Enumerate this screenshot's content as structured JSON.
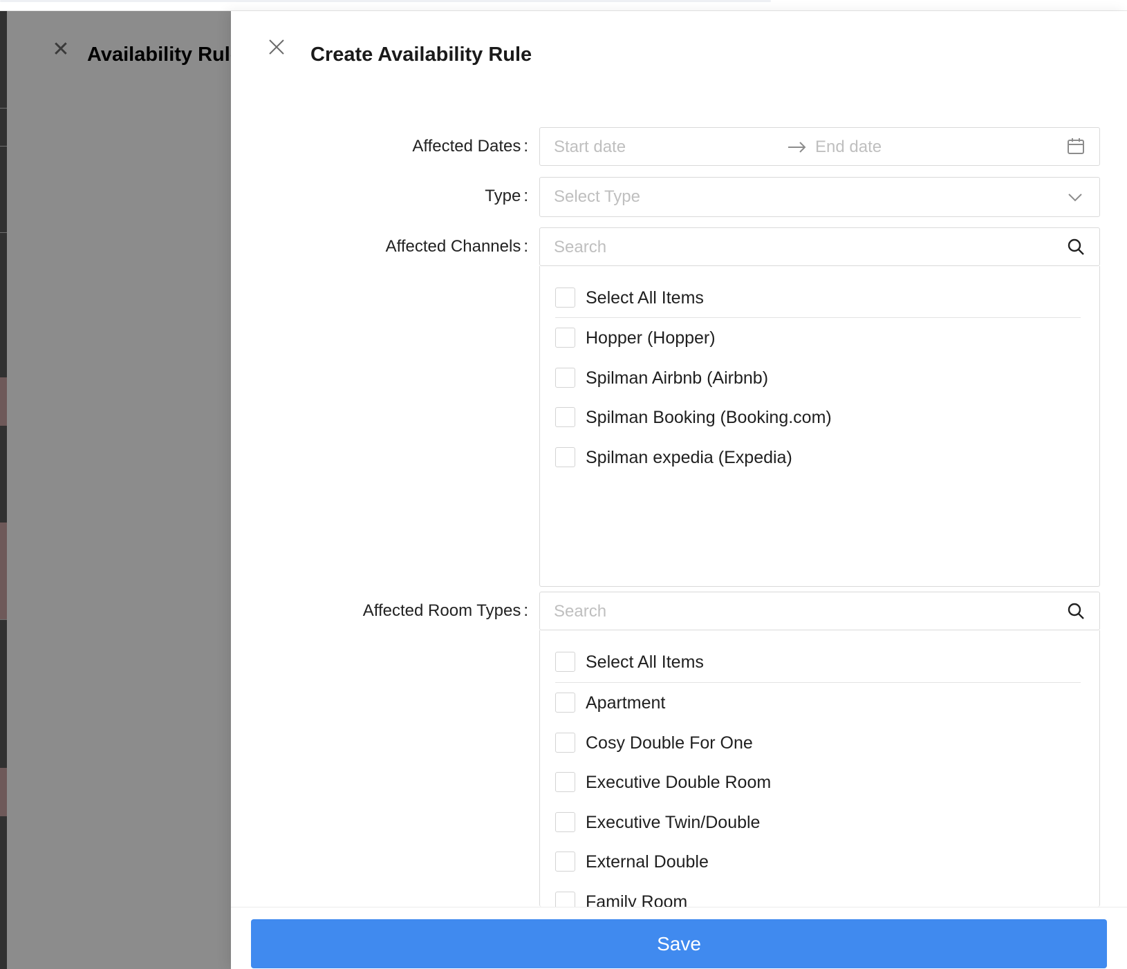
{
  "outer_drawer": {
    "title": "Availability Rule"
  },
  "drawer": {
    "title": "Create Availability Rule",
    "close_icon": "close-icon"
  },
  "form": {
    "dates": {
      "label": "Affected Dates",
      "colon": ":",
      "start_placeholder": "Start date",
      "end_placeholder": "End date",
      "separator_icon": "arrow-right-icon",
      "icon": "calendar-icon"
    },
    "type": {
      "label": "Type",
      "colon": ":",
      "placeholder": "Select Type",
      "icon": "chevron-down-icon"
    },
    "channels": {
      "label": "Affected Channels",
      "colon": ":",
      "search_placeholder": "Search",
      "icon": "search-icon",
      "select_all": "Select All Items",
      "items": [
        {
          "label": "Hopper (Hopper)",
          "checked": false
        },
        {
          "label": "Spilman Airbnb (Airbnb)",
          "checked": false
        },
        {
          "label": "Spilman Booking (Booking.com)",
          "checked": false
        },
        {
          "label": "Spilman expedia (Expedia)",
          "checked": false
        }
      ]
    },
    "room_types": {
      "label": "Affected Room Types",
      "colon": ":",
      "search_placeholder": "Search",
      "icon": "search-icon",
      "select_all": "Select All Items",
      "items": [
        {
          "label": "Apartment",
          "checked": false
        },
        {
          "label": "Cosy Double For One",
          "checked": false
        },
        {
          "label": "Executive Double Room",
          "checked": false
        },
        {
          "label": "Executive Twin/Double",
          "checked": false
        },
        {
          "label": "External Double",
          "checked": false
        },
        {
          "label": "Family Room",
          "checked": false
        }
      ]
    }
  },
  "footer": {
    "save_label": "Save"
  },
  "colors": {
    "primary": "#408aef",
    "placeholder": "#bfbfbf",
    "border": "#d9d9d9"
  }
}
